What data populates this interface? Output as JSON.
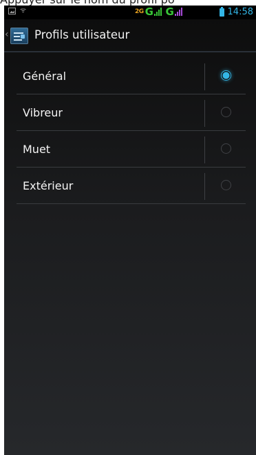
{
  "caption": "Appuyer sur le nom du profil po",
  "status_bar": {
    "time": "14:58",
    "network_labels": [
      "2G",
      "G",
      "G"
    ],
    "icons": [
      "image-notification-icon",
      "wifi-icon",
      "signal-icon",
      "battery-icon"
    ],
    "accent": "#33b5e5"
  },
  "action_bar": {
    "title": "Profils utilisateur",
    "back_icon": "chevron-left-icon",
    "app_icon": "user-profiles-icon"
  },
  "profiles": [
    {
      "label": "Général",
      "selected": true
    },
    {
      "label": "Vibreur",
      "selected": false
    },
    {
      "label": "Muet",
      "selected": false
    },
    {
      "label": "Extérieur",
      "selected": false
    }
  ]
}
